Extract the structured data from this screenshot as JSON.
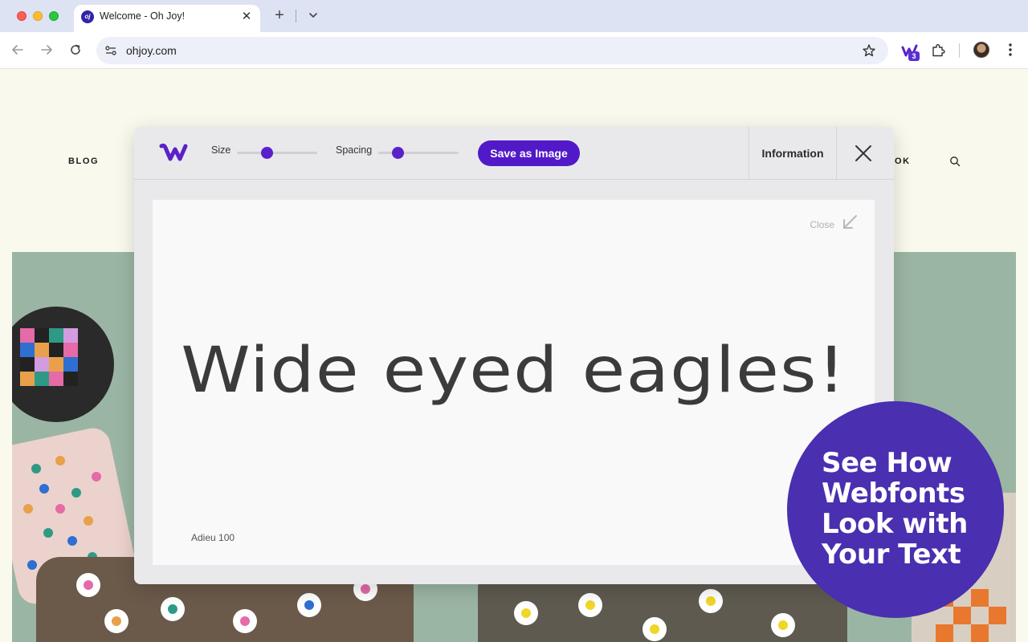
{
  "browser": {
    "tab": {
      "title": "Welcome - Oh Joy!",
      "favicon_text": "oj"
    },
    "address": {
      "url": "ohjoy.com"
    },
    "extension_badge": "3",
    "icons": [
      "back-icon",
      "forward-icon",
      "reload-icon",
      "site-info-icon",
      "star-icon",
      "webfonts-extension-icon",
      "puzzle-extension-icon",
      "profile-avatar",
      "more-menu-icon"
    ]
  },
  "page": {
    "nav": {
      "left_item": "BLOG",
      "right_item_partial": "OK"
    }
  },
  "panel": {
    "controls": {
      "size_label": "Size",
      "spacing_label": "Spacing",
      "size_value": 0.37,
      "spacing_value": 0.24
    },
    "save_button": "Save as Image",
    "information_button": "Information",
    "preview": {
      "close_label": "Close",
      "sample_text": "Wide eyed eagles!",
      "font_name": "Adieu 100"
    }
  },
  "promo": {
    "lines": [
      "See How",
      "Webfonts",
      "Look with",
      "Your Text"
    ]
  },
  "colors": {
    "accent": "#5219c9",
    "promo_bg": "#4a2fb0",
    "page_bg": "#faf9ee",
    "hero_bg": "#9bb5a4"
  }
}
